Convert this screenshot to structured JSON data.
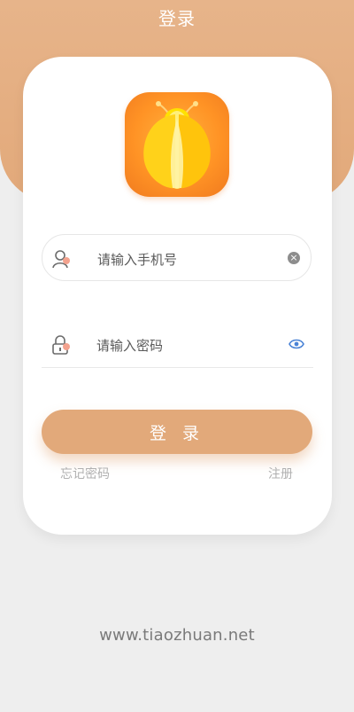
{
  "header": {
    "title": "登录"
  },
  "logo": {
    "icon": "firefly-icon",
    "colors": {
      "start": "#ff9325",
      "end": "#f07a1f",
      "wings": "#ffd21a"
    }
  },
  "phone_field": {
    "placeholder": "请输入手机号",
    "value": "",
    "clear_icon": "clear-icon",
    "user_icon": "user-icon"
  },
  "password_field": {
    "placeholder": "请输入密码",
    "value": "",
    "lock_icon": "lock-icon",
    "eye_icon": "eye-icon"
  },
  "login_button": {
    "label": "登 录"
  },
  "links": {
    "forgot": "忘记密码",
    "register": "注册"
  },
  "footer": {
    "watermark": "www.tiaozhuan.net"
  },
  "colors": {
    "accent": "#e2a97a",
    "background": "#eeeeee",
    "eye_blue": "#4a83d6"
  }
}
